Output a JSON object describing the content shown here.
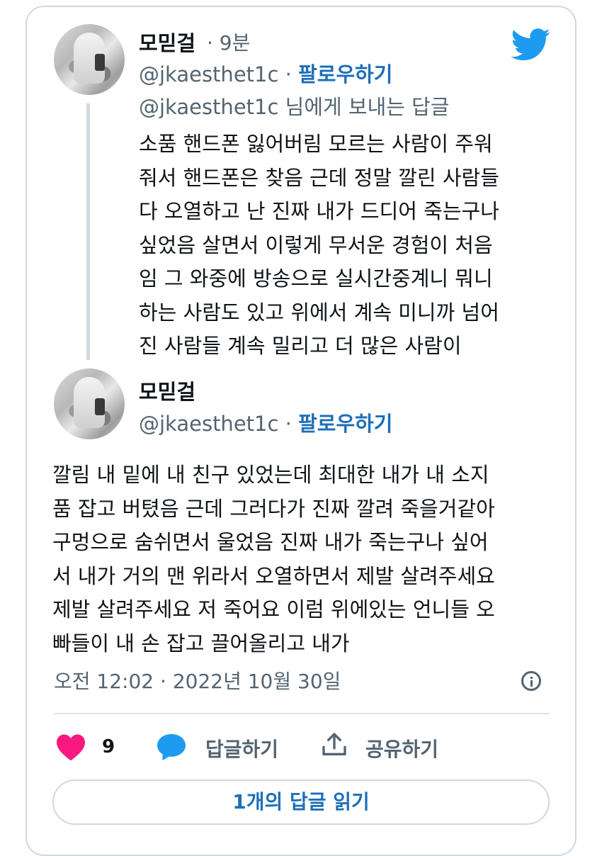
{
  "tweet1": {
    "name": "모믿걸",
    "time": "· 9분",
    "handle": "@jkaesthet1c",
    "separator": "·",
    "follow": "팔로우하기",
    "reply_to": "@jkaesthet1c 님에게 보내는 답글",
    "body_lines": [
      "소품 핸드폰 잃어버림 모르는 사람이 주워",
      "줘서 핸드폰은 찾음 근데 정말 깔린 사람들",
      "다 오열하고 난 진짜 내가 드디어 죽는구나",
      "싶었음 살면서 이렇게 무서운 경험이 처음",
      "임 그 와중에 방송으로 실시간중계니 뭐니",
      "하는 사람도 있고 위에서 계속 미니까 넘어",
      "진 사람들 계속 밀리고 더 많은 사람이"
    ]
  },
  "tweet2": {
    "name": "모믿걸",
    "handle": "@jkaesthet1c",
    "separator": "·",
    "follow": "팔로우하기",
    "body_lines": [
      "깔림 내 밑에 내 친구 있었는데 최대한 내가 내 소지",
      "품 잡고 버텼음 근데 그러다가 진짜 깔려 죽을거같아",
      "구멍으로 숨쉬면서 울었음 진짜 내가 죽는구나 싶어",
      "서 내가 거의 맨 위라서 오열하면서 제발 살려주세요",
      "제발 살려주세요 저 죽어요 이럼 위에있는 언니들 오",
      "빠들이 내 손 잡고 끌어올리고 내가"
    ],
    "timestamp": "오전 12:02 · 2022년 10월 30일"
  },
  "actions": {
    "like_count": "9",
    "reply_label": "답글하기",
    "share_label": "공유하기"
  },
  "read_replies_label": "1개의 답글 읽기",
  "colors": {
    "accent": "#1d9bf0",
    "follow": "#1d6fb8",
    "heart": "#f91880",
    "muted": "#536471"
  },
  "icons": [
    "twitter-bird-icon",
    "heart-icon",
    "reply-bubble-icon",
    "share-icon",
    "info-icon"
  ]
}
